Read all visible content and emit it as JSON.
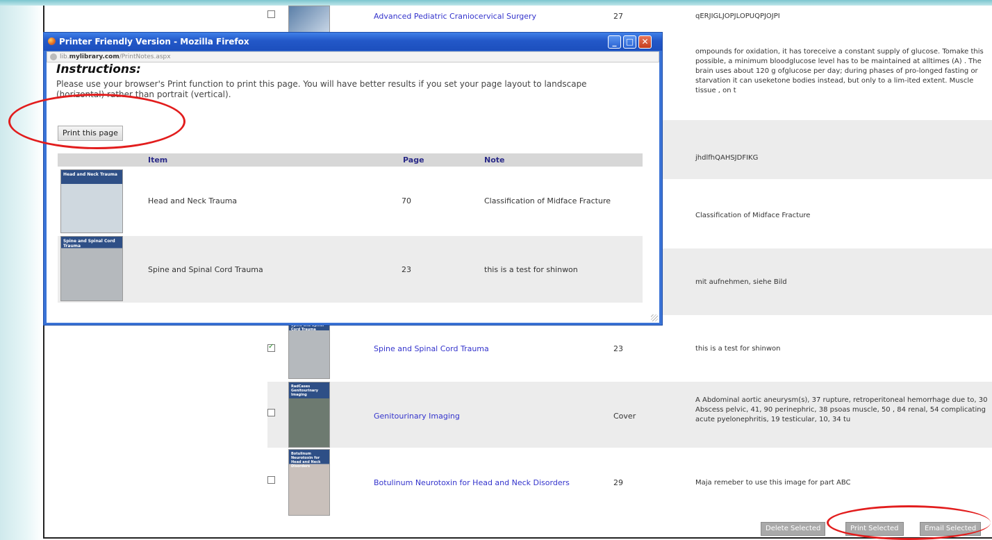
{
  "background_table": {
    "rows": [
      {
        "checked": false,
        "title": "Advanced Pediatric Craniocervical Surgery",
        "page": "27",
        "note": "qERJIGLJOPJLOPUQPJOJPI"
      },
      {
        "note": "ompounds for oxidation, it has toreceive a constant supply of glucose. Tomake this possible, a minimum bloodglucose level has to be maintained at alltimes (A) . The brain uses about 120 g ofglucose per day; during phases of pro-longed fasting or starvation it can useketone bodies instead, but only to a lim-ited extent. Muscle tissue , on t"
      },
      {
        "note": "jhdlfhQAHSJDFIKG"
      },
      {
        "note": "Classification of Midface Fracture"
      },
      {
        "note": "mit aufnehmen, siehe Bild"
      },
      {
        "checked": true,
        "title": "Spine and Spinal Cord Trauma",
        "page": "23",
        "note": "this is a test for shinwon",
        "thumb_title": "Spine and Spinal Cord Trauma"
      },
      {
        "checked": false,
        "title": "Genitourinary Imaging",
        "page": "Cover",
        "note": "A Abdominal aortic aneurysm(s), 37 rupture, retroperitoneal hemorrhage due to, 30 Abscess pelvic, 41, 90 perinephric, 38 psoas muscle, 50 , 84 renal, 54 complicating acute pyelonephritis, 19 testicular, 10, 34 tu",
        "thumb_title": "RadCases Genitourinary Imaging"
      },
      {
        "checked": false,
        "title": "Botulinum Neurotoxin for Head and Neck Disorders",
        "page": "29",
        "note": "Maja remeber to use this image for part ABC",
        "thumb_title": "Botulinum Neurotoxin for Head and Neck Disorders"
      }
    ],
    "buttons": {
      "delete": "Delete Selected",
      "print": "Print Selected",
      "email": "Email Selected"
    }
  },
  "popup": {
    "window_title": "Printer Friendly Version - Mozilla Firefox",
    "url_host": "lib.",
    "url_host_bold": "mylibrary.com",
    "url_path": "/PrintNotes.aspx",
    "heading": "Instructions:",
    "instructions": "Please use your browser's Print function to print this page. You will have better results if you set your page layout to landscape (horizontal) rather than portrait (vertical).",
    "print_button": "Print this page",
    "columns": {
      "item": "Item",
      "page": "Page",
      "note": "Note"
    },
    "rows": [
      {
        "item": "Head and Neck Trauma",
        "page": "70",
        "note": "Classification of Midface Fracture",
        "thumb_title": "Head and Neck Trauma"
      },
      {
        "item": "Spine and Spinal Cord Trauma",
        "page": "23",
        "note": "this is a test for shinwon",
        "thumb_title": "Spine and Spinal Cord Trauma"
      }
    ]
  },
  "colors": {
    "link": "#3333cc",
    "titlebar": "#2358c8",
    "annotation": "#e21d1d",
    "button_gray": "#a9a9a9"
  }
}
